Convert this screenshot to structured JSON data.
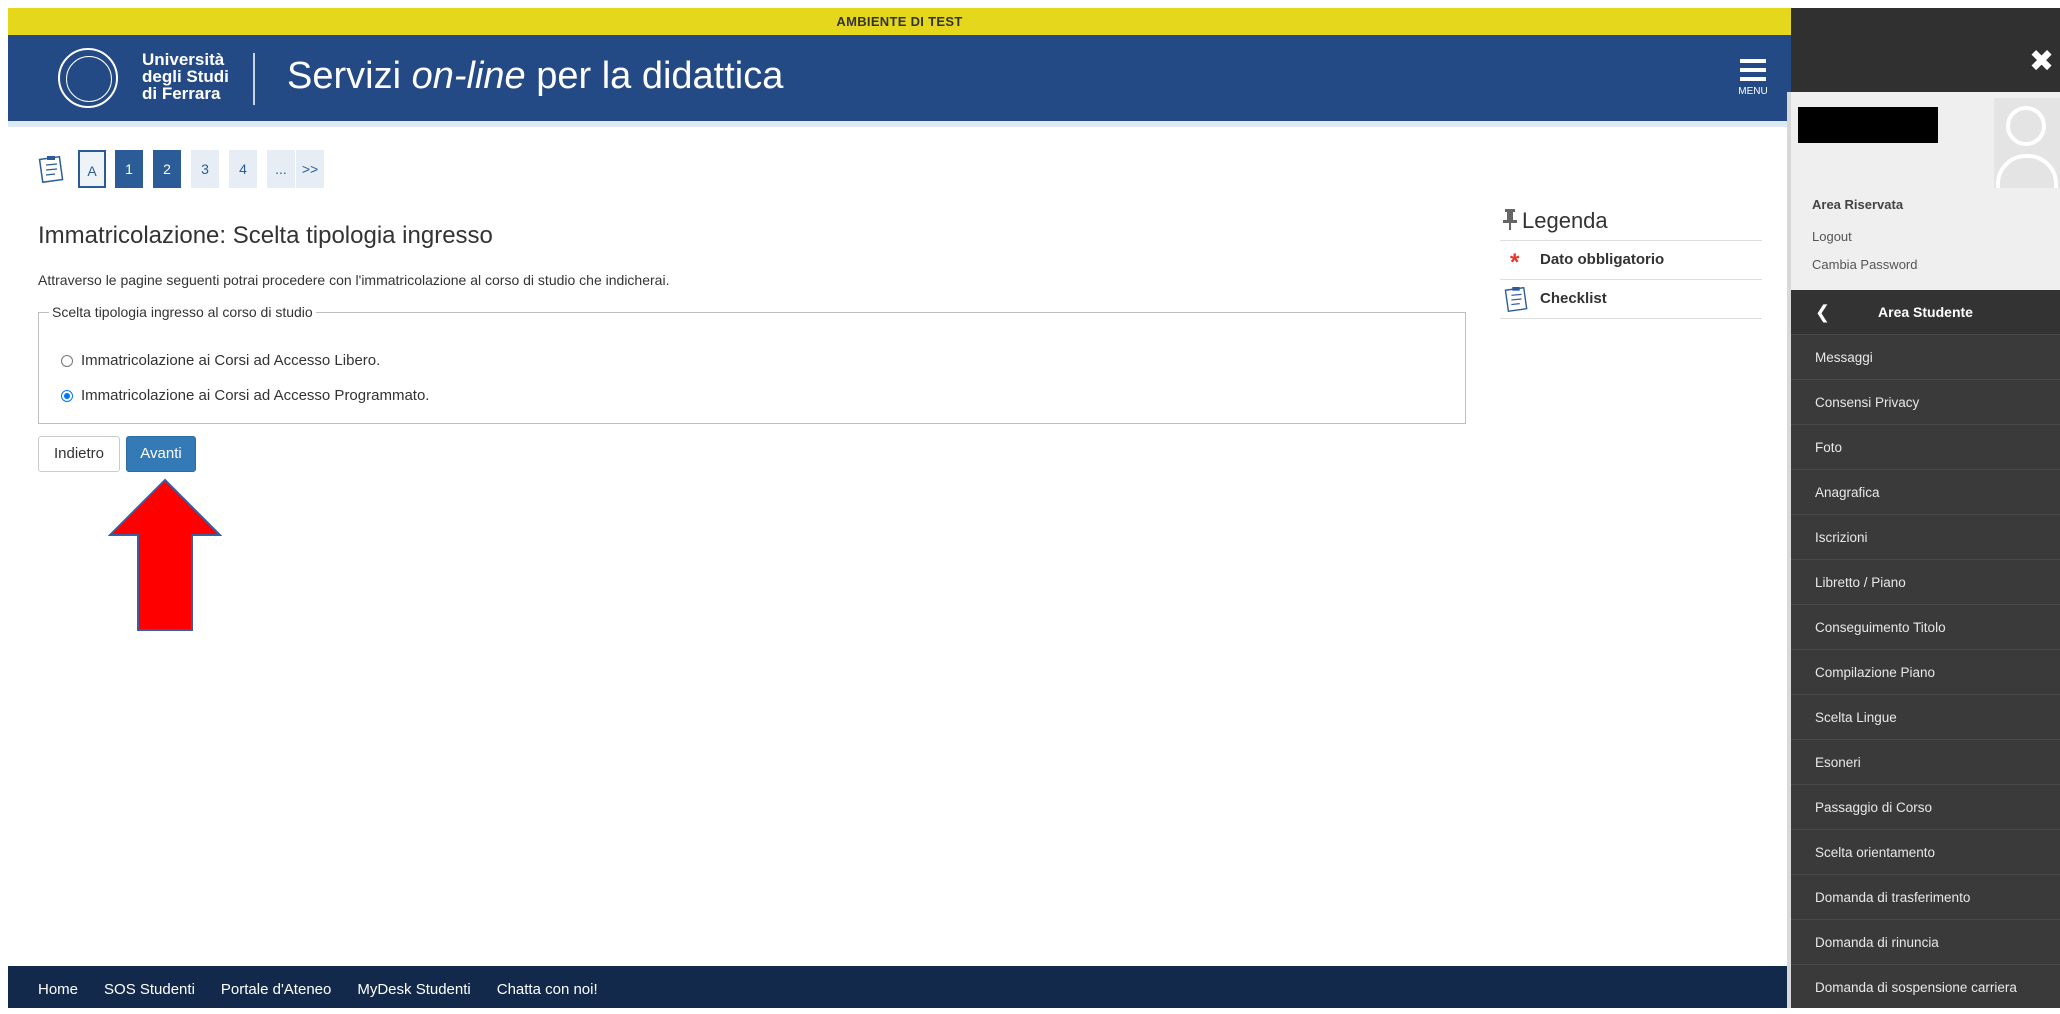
{
  "banner": {
    "text": "AMBIENTE DI TEST"
  },
  "header": {
    "logo_lines": [
      "Università",
      "degli Studi",
      "di Ferrara"
    ],
    "title_start": "Servizi ",
    "title_italic": "on-line",
    "title_end": " per la didattica",
    "menu_label": "MENU"
  },
  "steps": [
    "A",
    "1",
    "2",
    "3",
    "4",
    "...",
    ">>"
  ],
  "main": {
    "title": "Immatricolazione: Scelta tipologia ingresso",
    "intro": "Attraverso le pagine seguenti potrai procedere con l'immatricolazione al corso di studio che indicherai.",
    "fieldset_legend": "Scelta tipologia ingresso al corso di studio",
    "options": [
      {
        "label": "Immatricolazione ai Corsi ad Accesso Libero.",
        "selected": false
      },
      {
        "label": "Immatricolazione ai Corsi ad Accesso Programmato.",
        "selected": true
      }
    ],
    "back_label": "Indietro",
    "next_label": "Avanti"
  },
  "legend": {
    "title": "Legenda",
    "required": "Dato obbligatorio",
    "checklist": "Checklist"
  },
  "footer": {
    "links": [
      "Home",
      "SOS Studenti",
      "Portale d'Ateneo",
      "MyDesk Studenti",
      "Chatta con noi!"
    ]
  },
  "side": {
    "area_label": "Area Riservata",
    "logout": "Logout",
    "change_password": "Cambia Password",
    "menu_title": "Area Studente",
    "items": [
      "Messaggi",
      "Consensi Privacy",
      "Foto",
      "Anagrafica",
      "Iscrizioni",
      "Libretto / Piano",
      "Conseguimento Titolo",
      "Compilazione Piano",
      "Scelta Lingue",
      "Esoneri",
      "Passaggio di Corso",
      "Scelta orientamento",
      "Domanda di trasferimento",
      "Domanda di rinuncia",
      "Domanda di sospensione carriera"
    ]
  },
  "colors": {
    "header": "#244a86",
    "banner": "#e5d81c",
    "footer": "#13294b",
    "button_primary": "#337ab7",
    "side_menu": "#3a3a3a",
    "arrow": "#ff0000"
  }
}
